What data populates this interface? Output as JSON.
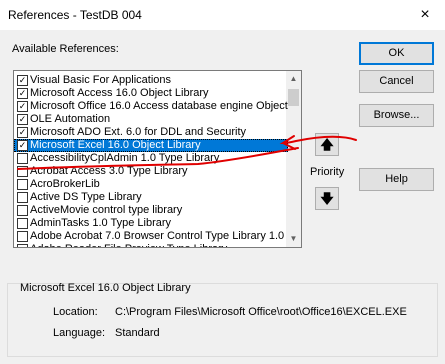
{
  "window": {
    "title": "References - TestDB 004",
    "close_glyph": "×"
  },
  "available_label": "Available References:",
  "references": [
    {
      "label": "Visual Basic For Applications",
      "checked": true,
      "selected": false
    },
    {
      "label": "Microsoft Access 16.0 Object Library",
      "checked": true,
      "selected": false
    },
    {
      "label": "Microsoft Office 16.0 Access database engine Object",
      "checked": true,
      "selected": false
    },
    {
      "label": "OLE Automation",
      "checked": true,
      "selected": false
    },
    {
      "label": "Microsoft ADO Ext. 6.0 for DDL and Security",
      "checked": true,
      "selected": false
    },
    {
      "label": "Microsoft Excel 16.0 Object Library",
      "checked": true,
      "selected": true
    },
    {
      "label": "AccessibilityCplAdmin 1.0 Type Library",
      "checked": false,
      "selected": false
    },
    {
      "label": "Acrobat Access 3.0 Type Library",
      "checked": false,
      "selected": false
    },
    {
      "label": "AcroBrokerLib",
      "checked": false,
      "selected": false
    },
    {
      "label": "Active DS Type Library",
      "checked": false,
      "selected": false
    },
    {
      "label": "ActiveMovie control type library",
      "checked": false,
      "selected": false
    },
    {
      "label": "AdminTasks 1.0 Type Library",
      "checked": false,
      "selected": false
    },
    {
      "label": "Adobe Acrobat 7.0 Browser Control Type Library 1.0",
      "checked": false,
      "selected": false
    },
    {
      "label": "Adobe Reader File Preview Type Library",
      "checked": false,
      "selected": false
    }
  ],
  "buttons": {
    "ok": "OK",
    "cancel": "Cancel",
    "browse": "Browse...",
    "help": "Help"
  },
  "priority": {
    "label": "Priority",
    "up_glyph": "🡅",
    "down_glyph": "🡇"
  },
  "selection": {
    "title": "Microsoft Excel 16.0 Object Library",
    "location_label": "Location:",
    "location_value": "C:\\Program Files\\Microsoft Office\\root\\Office16\\EXCEL.EXE",
    "language_label": "Language:",
    "language_value": "Standard"
  },
  "annotation_color": "#e00000",
  "accent_color": "#0078d7"
}
